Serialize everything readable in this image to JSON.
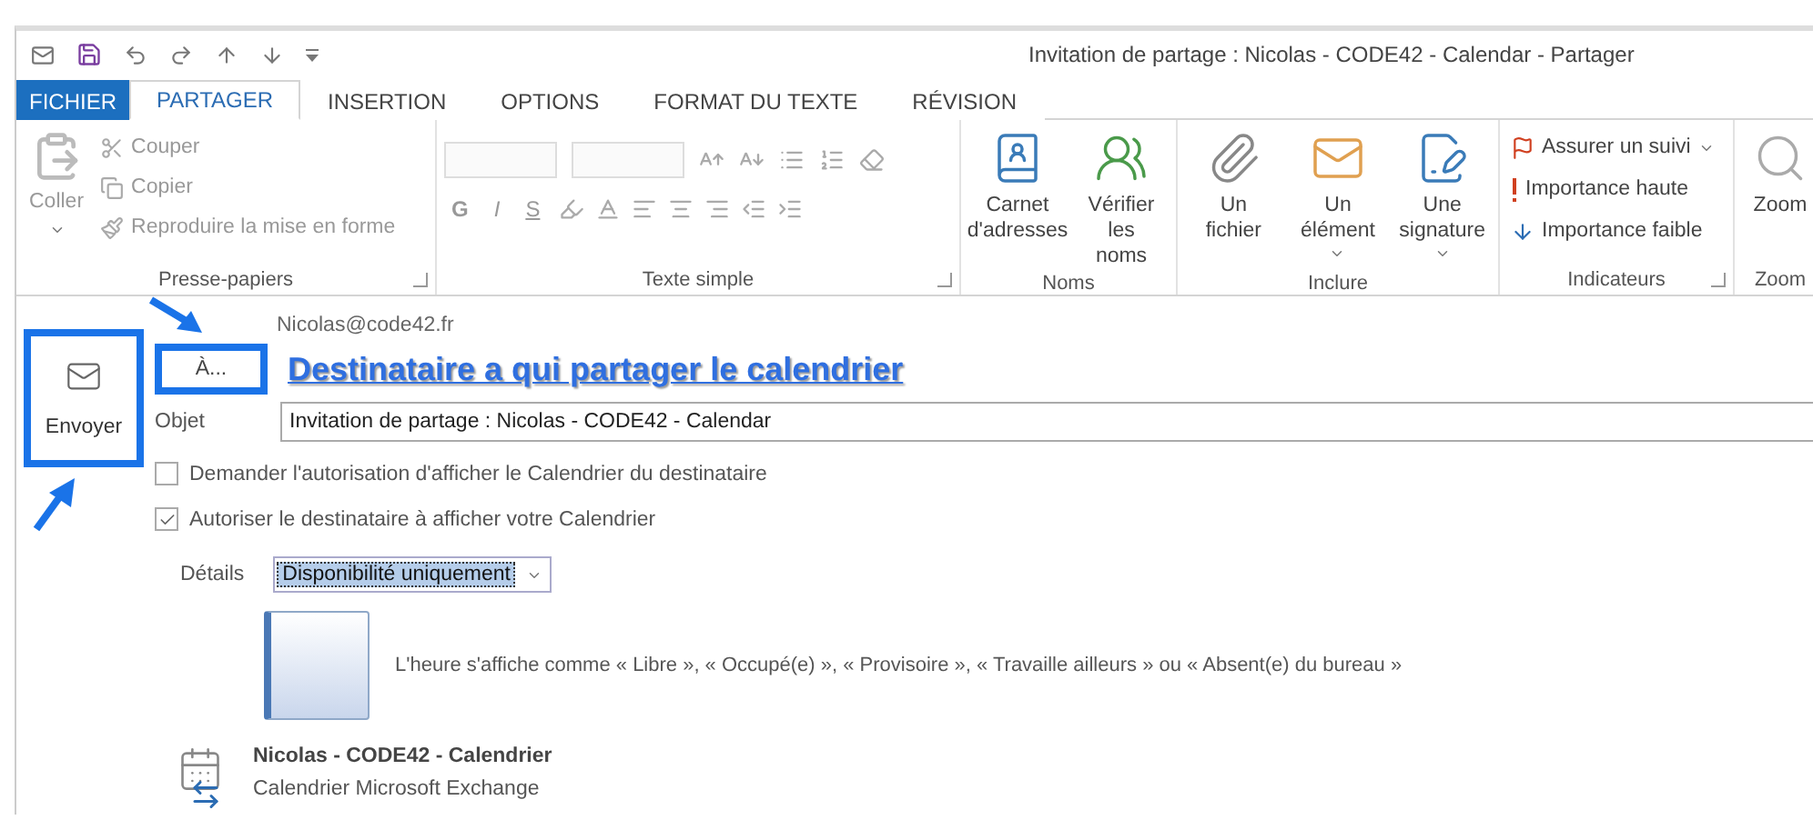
{
  "window": {
    "title": "Invitation de partage : Nicolas - CODE42 - Calendar - Partager"
  },
  "tabs": [
    {
      "label": "FICHIER",
      "kind": "file",
      "selected": false
    },
    {
      "label": "PARTAGER",
      "kind": "tab",
      "selected": true
    },
    {
      "label": "INSERTION",
      "kind": "tab",
      "selected": false
    },
    {
      "label": "OPTIONS",
      "kind": "tab",
      "selected": false
    },
    {
      "label": "FORMAT DU TEXTE",
      "kind": "tab",
      "selected": false
    },
    {
      "label": "RÉVISION",
      "kind": "tab",
      "selected": false
    }
  ],
  "ribbon": [
    {
      "label": "Presse-papiers",
      "kind": "clipboard",
      "disabled": true,
      "launcher": true,
      "buttons": [
        {
          "label": "Coller",
          "has_menu": true
        },
        {
          "label": "Couper",
          "has_menu": false
        },
        {
          "label": "Copier",
          "has_menu": false
        },
        {
          "label": "Reproduire la mise en forme",
          "has_menu": false
        }
      ]
    },
    {
      "label": "Texte simple",
      "kind": "text",
      "disabled": true,
      "launcher": true,
      "buttons": [
        {
          "label": "G",
          "has_menu": false
        },
        {
          "label": "I",
          "has_menu": false
        },
        {
          "label": "S",
          "has_menu": false
        }
      ]
    },
    {
      "label": "Noms",
      "kind": "large",
      "disabled": false,
      "launcher": false,
      "buttons": [
        {
          "label": "Carnet d'adresses",
          "has_menu": false
        },
        {
          "label": "Vérifier les noms",
          "has_menu": false
        }
      ]
    },
    {
      "label": "Inclure",
      "kind": "large",
      "disabled": false,
      "launcher": false,
      "buttons": [
        {
          "label": "Un fichier",
          "has_menu": false
        },
        {
          "label": "Un élément",
          "has_menu": true
        },
        {
          "label": "Une signature",
          "has_menu": true
        }
      ]
    },
    {
      "label": "Indicateurs",
      "kind": "small",
      "disabled": false,
      "launcher": true,
      "buttons": [
        {
          "label": "Assurer un suivi",
          "has_menu": true
        },
        {
          "label": "Importance haute",
          "has_menu": false
        },
        {
          "label": "Importance faible",
          "has_menu": false
        }
      ]
    },
    {
      "label": "Zoom",
      "kind": "large",
      "disabled": false,
      "launcher": false,
      "buttons": [
        {
          "label": "Zoom",
          "has_menu": false
        }
      ]
    }
  ],
  "compose": {
    "send": {
      "label": "Envoyer",
      "highlighted": true
    },
    "from": "Nicolas@code42.fr",
    "to": {
      "button": "À...",
      "highlighted": true,
      "value": "Destinataire a qui partager le calendrier"
    },
    "subject": {
      "label": "Objet",
      "value": "Invitation de partage : Nicolas - CODE42 - Calendar"
    },
    "options": [
      {
        "label": "Demander l'autorisation d'afficher le Calendrier du destinataire",
        "checked": false
      },
      {
        "label": "Autoriser le destinataire à afficher votre Calendrier",
        "checked": true
      }
    ],
    "details": {
      "label": "Détails",
      "value": "Disponibilité uniquement"
    },
    "preview_text": "L'heure s'affiche comme « Libre », « Occupé(e) », « Provisoire », « Travaille ailleurs » ou « Absent(e) du bureau »",
    "calendar": {
      "name": "Nicolas - CODE42 - Calendrier",
      "type": "Calendrier Microsoft Exchange"
    }
  }
}
